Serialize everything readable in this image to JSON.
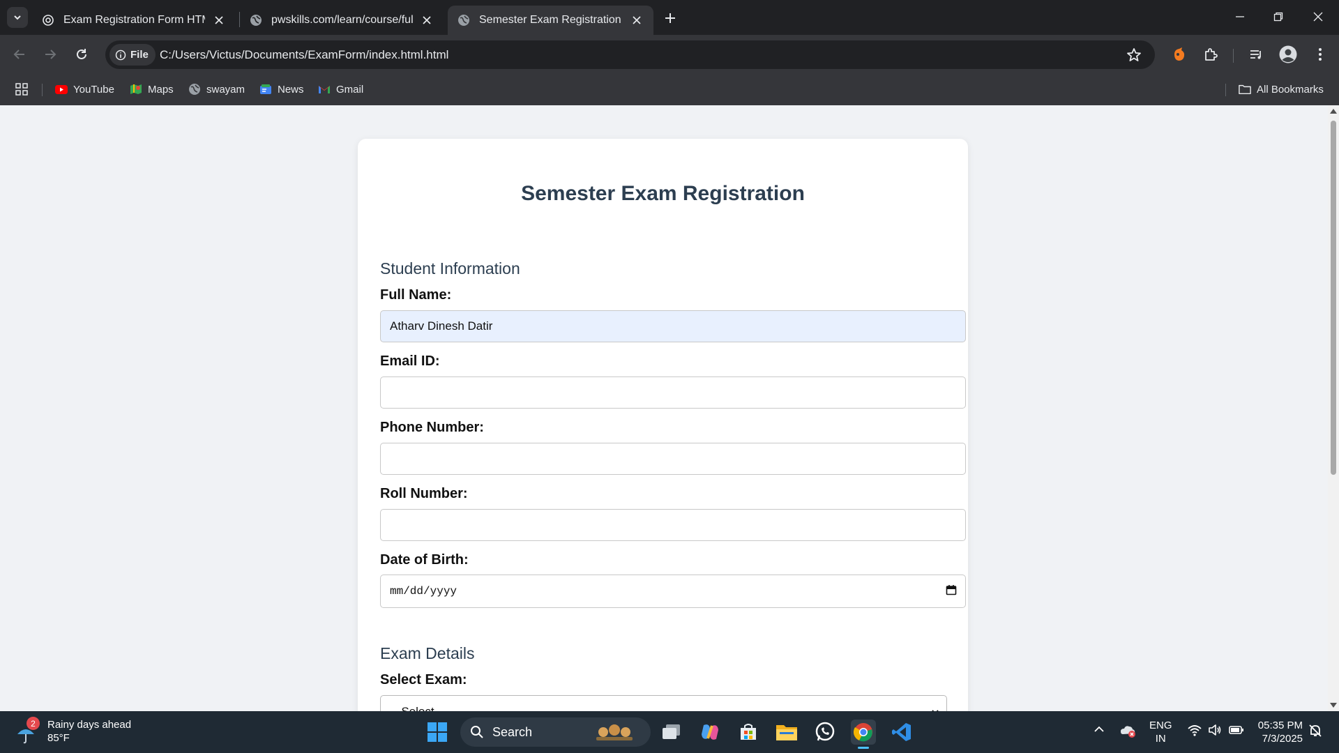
{
  "browser": {
    "tabs": [
      {
        "title": "Exam Registration Form HTML",
        "icon": "openai-icon",
        "active": false
      },
      {
        "title": "pwskills.com/learn/course/full-s",
        "icon": "globe-icon",
        "active": false
      },
      {
        "title": "Semester Exam Registration",
        "icon": "globe-icon",
        "active": true
      }
    ],
    "address": {
      "chip_label": "File",
      "url": "C:/Users/Victus/Documents/ExamForm/index.html.html"
    },
    "bookmarks": [
      {
        "label": "YouTube",
        "icon": "youtube-icon"
      },
      {
        "label": "Maps",
        "icon": "maps-icon"
      },
      {
        "label": "swayam",
        "icon": "globe-icon"
      },
      {
        "label": "News",
        "icon": "news-icon"
      },
      {
        "label": "Gmail",
        "icon": "gmail-icon"
      }
    ],
    "all_bookmarks_label": "All Bookmarks"
  },
  "page": {
    "heading": "Semester Exam Registration",
    "student_section": "Student Information",
    "full_name": {
      "label": "Full Name:",
      "value": "Atharv Dinesh Datir"
    },
    "email": {
      "label": "Email ID:",
      "value": ""
    },
    "phone": {
      "label": "Phone Number:",
      "value": ""
    },
    "roll": {
      "label": "Roll Number:",
      "value": ""
    },
    "dob": {
      "label": "Date of Birth:",
      "placeholder": "mm/dd/yyyy"
    },
    "exam_section": "Exam Details",
    "exam_select": {
      "label": "Select Exam:",
      "selected": "--Select--"
    }
  },
  "taskbar": {
    "weather": {
      "headline": "Rainy days ahead",
      "temp": "85°F",
      "badge": "2"
    },
    "search_label": "Search",
    "language": {
      "line1": "ENG",
      "line2": "IN"
    },
    "clock": {
      "time": "05:35 PM",
      "date": "7/3/2025"
    }
  },
  "colors": {
    "page_bg": "#f0f2f5",
    "heading": "#2c3e50",
    "filled_input_bg": "#e8f0fe",
    "browser_dark": "#202124",
    "browser_toolbar": "#35363a",
    "taskbar": "#1f2a34"
  }
}
